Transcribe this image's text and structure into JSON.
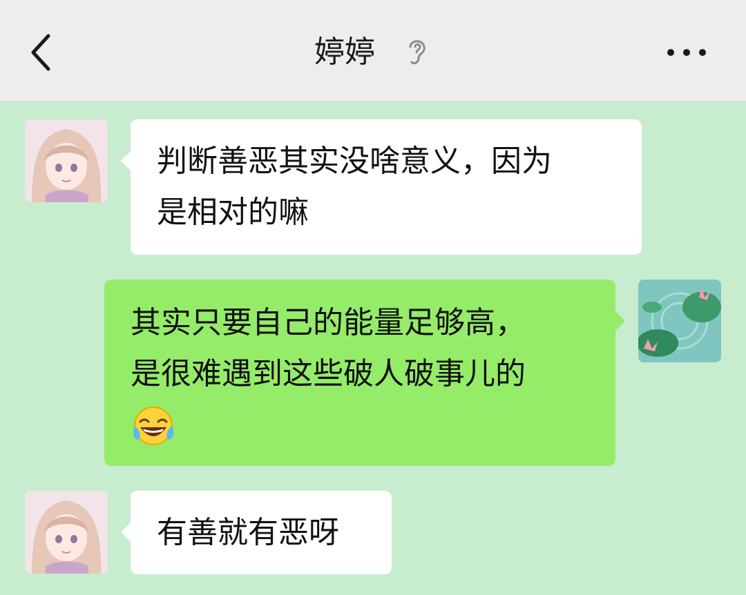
{
  "header": {
    "title": "婷婷",
    "back_icon": "chevron-left-icon",
    "status_icon": "ear-icon",
    "more_icon": "more-dots-icon"
  },
  "messages": [
    {
      "sender": "contact",
      "lines": [
        "判断善恶其实没啥意义，因为",
        "是相对的嘛"
      ]
    },
    {
      "sender": "self",
      "lines": [
        "其实只要自己的能量足够高，",
        "是很难遇到这些破人破事儿的"
      ],
      "emoji": "tears-of-joy-emoji"
    },
    {
      "sender": "contact",
      "lines": [
        "有善就有恶呀"
      ]
    }
  ],
  "colors": {
    "chat_bg": "#c8ecce",
    "header_bg": "#ededed",
    "incoming_bubble": "#ffffff",
    "outgoing_bubble": "#95ec69"
  }
}
